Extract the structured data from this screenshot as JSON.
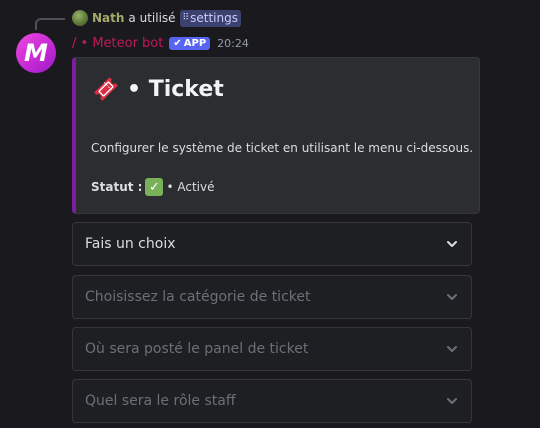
{
  "reply": {
    "user": "Nath",
    "verb": "a utilisé",
    "command": "settings"
  },
  "message": {
    "bot_name": "/ • Meteor bot",
    "badge": "APP",
    "timestamp": "20:24",
    "avatar_letter": "M"
  },
  "embed": {
    "title": "• Ticket",
    "description": "Configurer le système de ticket en utilisant le menu ci-dessous.",
    "status_label": "Statut :",
    "status_value": "• Activé",
    "accent_color": "#7b1fa2"
  },
  "selects": [
    {
      "placeholder": "Fais un choix"
    },
    {
      "placeholder": "Choisissez la catégorie de ticket"
    },
    {
      "placeholder": "Où sera posté le panel de ticket"
    },
    {
      "placeholder": "Quel sera le rôle staff"
    }
  ],
  "icons": {
    "reply_avatar": "user-avatar-icon",
    "command": "slash-command-icon",
    "badge_check": "checkmark-icon",
    "embed_title": "ticket-icon",
    "status": "check-mark-button-icon",
    "select_arrow": "chevron-down-icon"
  }
}
